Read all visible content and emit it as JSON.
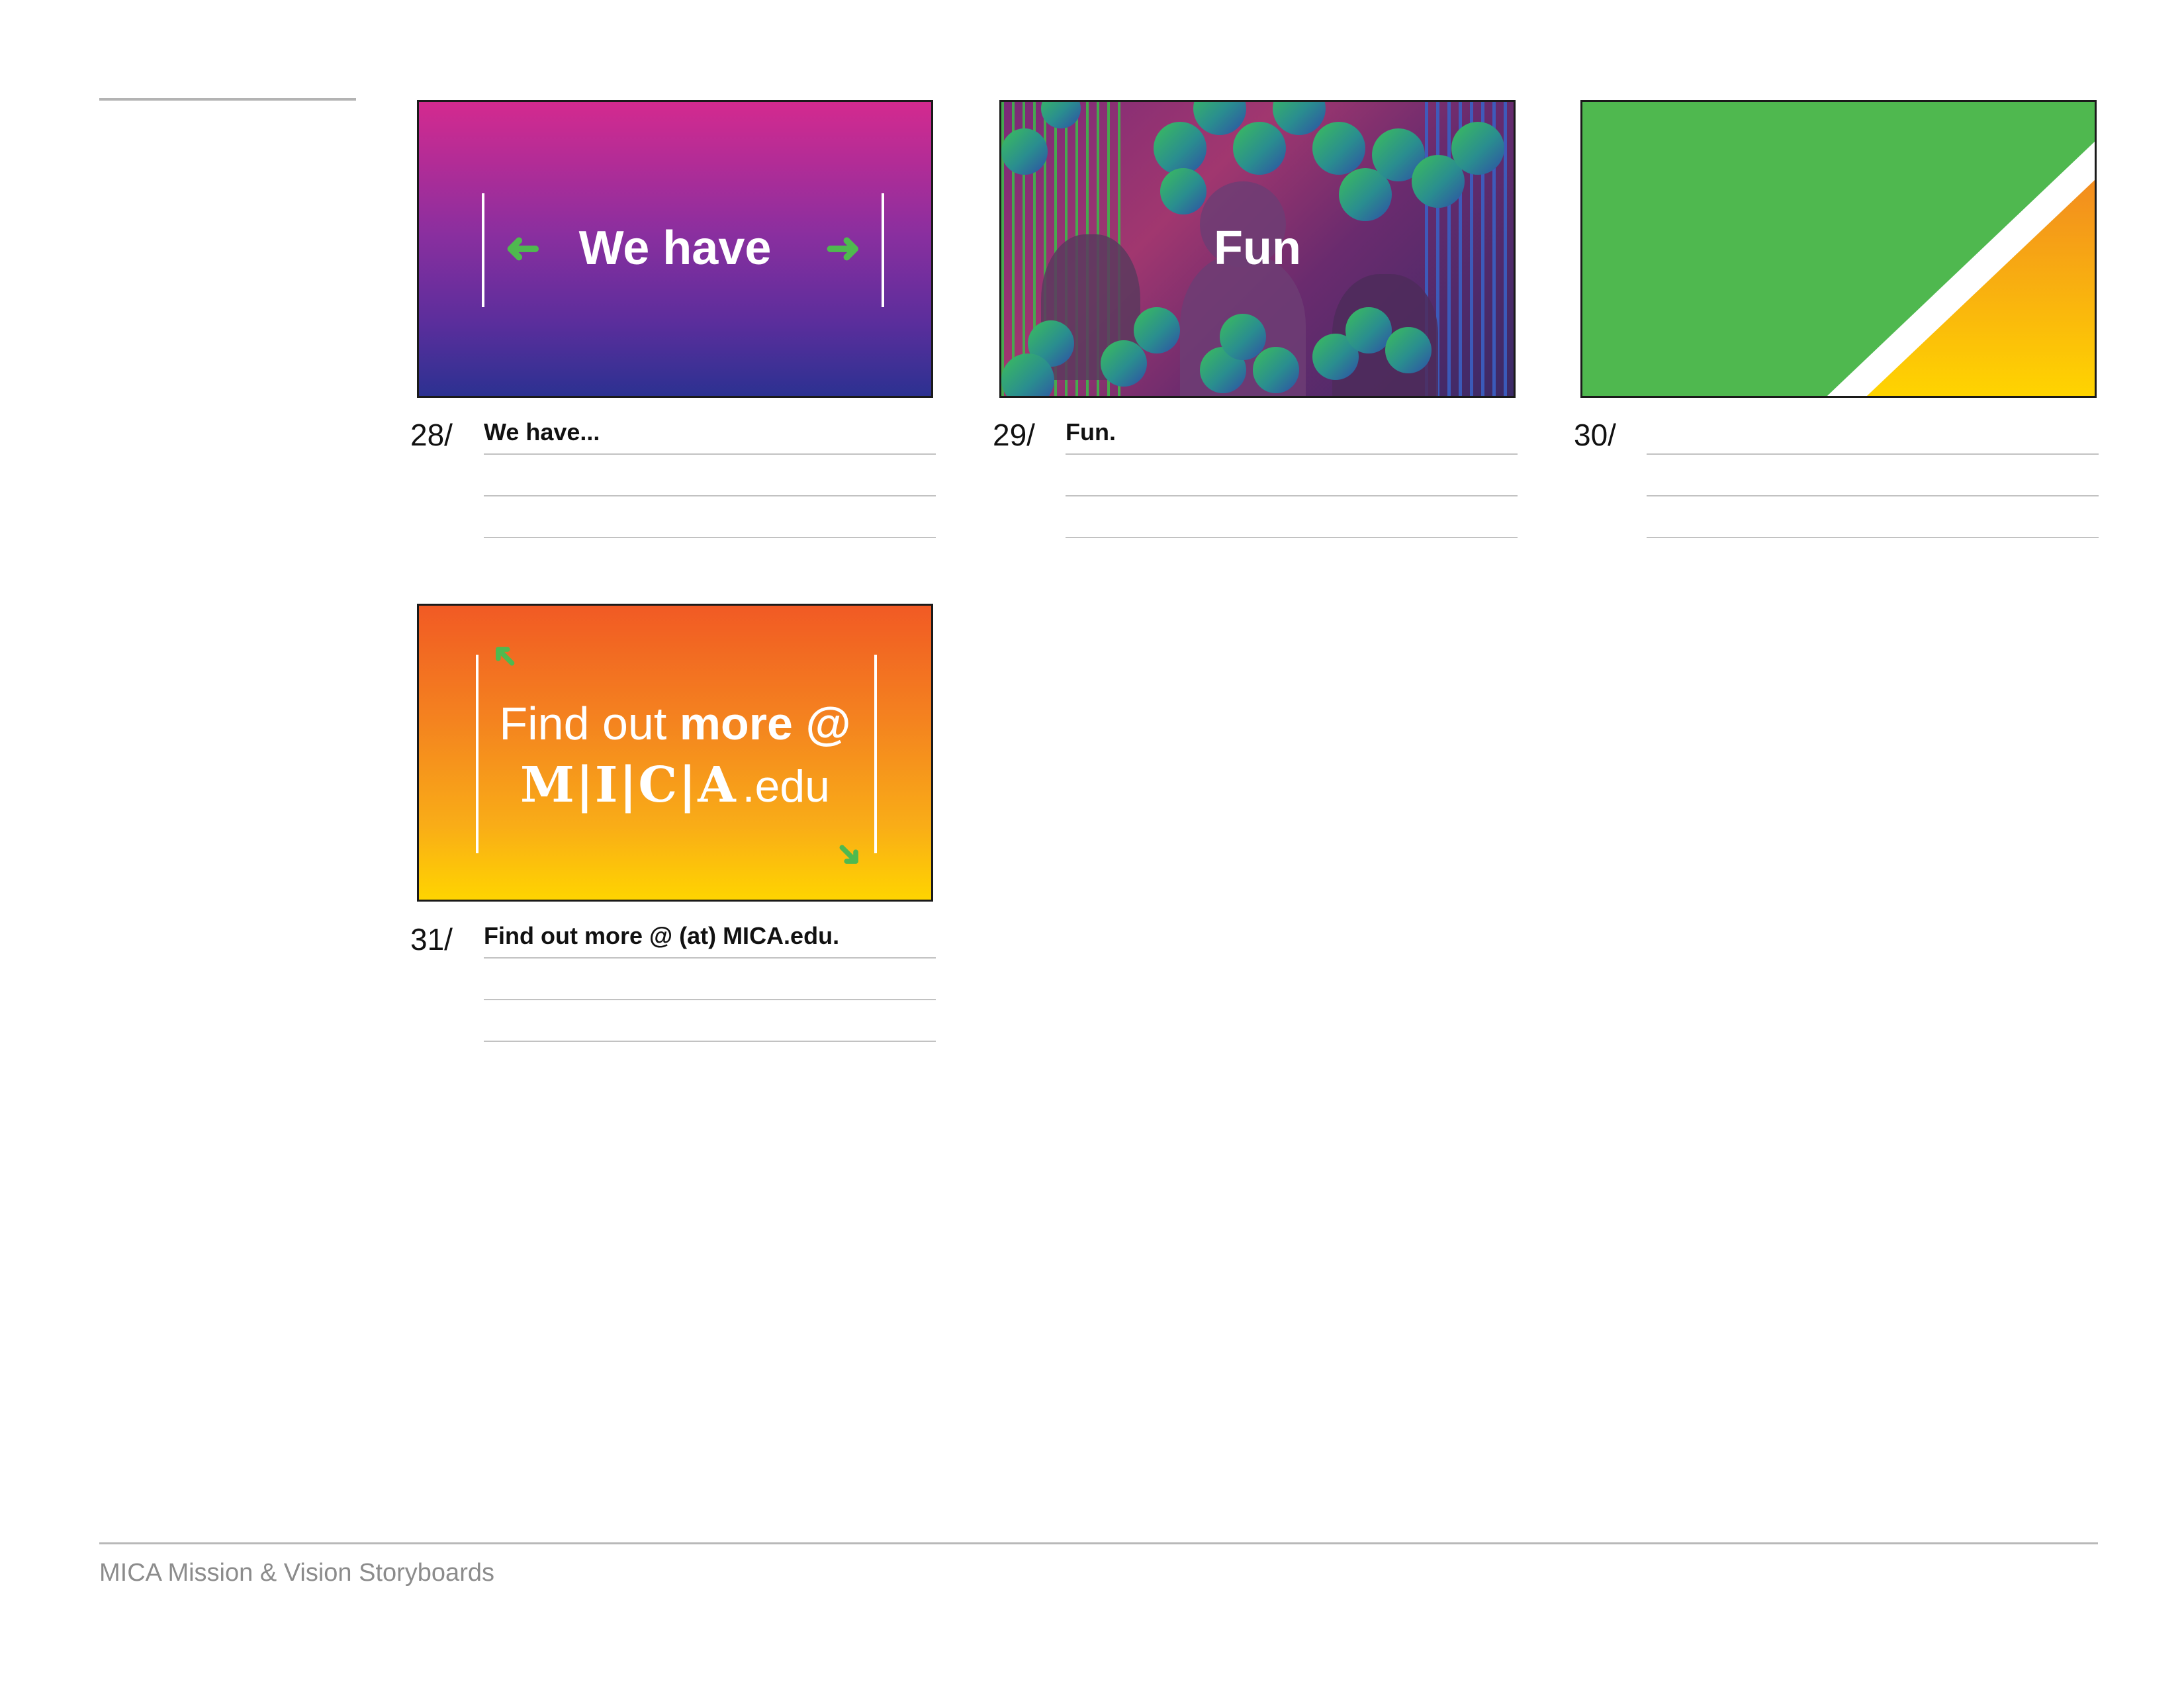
{
  "footer": {
    "title": "MICA Mission & Vision Storyboards"
  },
  "frames": [
    {
      "number": "28/",
      "caption": "We have...",
      "slide_text": "We have",
      "left_arrow": "➜",
      "right_arrow": "➜"
    },
    {
      "number": "29/",
      "caption": "Fun.",
      "slide_text": "Fun"
    },
    {
      "number": "30/",
      "caption": ""
    },
    {
      "number": "31/",
      "caption": "Find out more @ (at) MICA.edu.",
      "slide_line1_regular": "Find out ",
      "slide_line1_bold": "more @",
      "logo_letters": [
        "M",
        "I",
        "C",
        "A"
      ],
      "logo_separator": "|",
      "logo_suffix": ".edu",
      "arrow_top": "➜",
      "arrow_bottom": "➜"
    }
  ],
  "colors": {
    "accent_green": "#4fb94f",
    "frame28_top": "#d42a8f",
    "frame28_bottom": "#2c3191",
    "frame30_green": "#4fb84f",
    "frame30_orange": "#f28c1f",
    "frame30_yellow": "#ffd400",
    "frame31_top": "#f15a24",
    "frame31_bottom": "#ffd400"
  }
}
